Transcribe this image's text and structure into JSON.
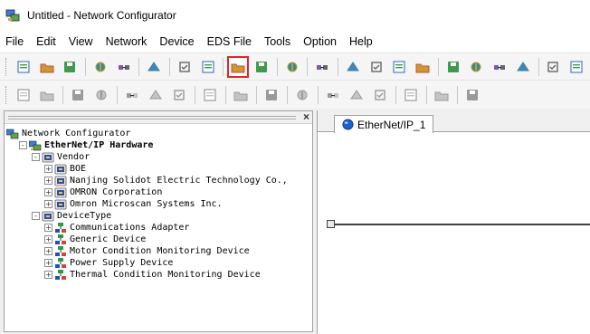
{
  "window": {
    "title": "Untitled - Network Configurator"
  },
  "menu": [
    "File",
    "Edit",
    "View",
    "Network",
    "Device",
    "EDS File",
    "Tools",
    "Option",
    "Help"
  ],
  "toolbar1": {
    "groups": [
      [
        "new-icon",
        "open-icon",
        "save-icon"
      ],
      [
        "online-icon",
        "upload-icon"
      ],
      [
        "connect-icon"
      ],
      [
        "monitor-icon",
        "monitor-alt-icon"
      ],
      [
        "network-wizard-icon",
        "network-alt-icon"
      ],
      [
        "parameter-icon"
      ],
      [
        "print-icon"
      ],
      [
        "cut-icon",
        "copy-icon",
        "paste-icon",
        "delete-icon"
      ],
      [
        "large-icons-icon",
        "small-icons-icon",
        "list-view-icon",
        "details-view-icon"
      ],
      [
        "property-icon",
        "compare-icon"
      ]
    ],
    "highlighted": "network-wizard-icon"
  },
  "toolbar2": {
    "groups": [
      [
        "search-device-icon",
        "register-icon"
      ],
      [
        "download-icon",
        "upload-param-icon"
      ],
      [
        "move-up-icon",
        "move-down-icon",
        "check-icon"
      ],
      [
        "device-list-icon"
      ],
      [
        "monitor-params-icon"
      ],
      [
        "config-icon"
      ],
      [
        "setup-icon"
      ],
      [
        "add-device-icon",
        "remove-device-icon",
        "replace-icon"
      ],
      [
        "zoom-icon"
      ],
      [
        "find-icon"
      ],
      [
        "info-icon"
      ]
    ]
  },
  "leftPane": {
    "close_label": "×",
    "tree": [
      {
        "label": "Network Configurator",
        "depth": 0,
        "expander": "",
        "icon": "network-configurator-icon",
        "bold": false
      },
      {
        "label": "EtherNet/IP Hardware",
        "depth": 1,
        "expander": "-",
        "icon": "hardware-icon",
        "bold": true
      },
      {
        "label": "Vendor",
        "depth": 2,
        "expander": "-",
        "icon": "folder-icon",
        "bold": false
      },
      {
        "label": "BOE",
        "depth": 3,
        "expander": "+",
        "icon": "folder-icon",
        "bold": false
      },
      {
        "label": "Nanjing Solidot Electric Technology Co.,",
        "depth": 3,
        "expander": "+",
        "icon": "folder-icon",
        "bold": false
      },
      {
        "label": "OMRON Corporation",
        "depth": 3,
        "expander": "+",
        "icon": "folder-icon",
        "bold": false
      },
      {
        "label": "Omron Microscan Systems Inc.",
        "depth": 3,
        "expander": "+",
        "icon": "folder-icon",
        "bold": false
      },
      {
        "label": "DeviceType",
        "depth": 2,
        "expander": "-",
        "icon": "folder-icon",
        "bold": false
      },
      {
        "label": "Communications Adapter",
        "depth": 3,
        "expander": "+",
        "icon": "device-type-icon",
        "bold": false
      },
      {
        "label": "Generic Device",
        "depth": 3,
        "expander": "+",
        "icon": "device-type-icon",
        "bold": false
      },
      {
        "label": "Motor Condition Monitoring Device",
        "depth": 3,
        "expander": "+",
        "icon": "device-type-icon",
        "bold": false
      },
      {
        "label": "Power Supply Device",
        "depth": 3,
        "expander": "+",
        "icon": "device-type-icon",
        "bold": false
      },
      {
        "label": "Thermal Condition Monitoring Device",
        "depth": 3,
        "expander": "+",
        "icon": "device-type-icon",
        "bold": false
      }
    ]
  },
  "rightPane": {
    "tab": {
      "label": "EtherNet/IP_1",
      "icon": "ethernet-ip-icon"
    }
  },
  "colors": {
    "highlight_border": "#e0262b",
    "network_line": "#404040"
  }
}
